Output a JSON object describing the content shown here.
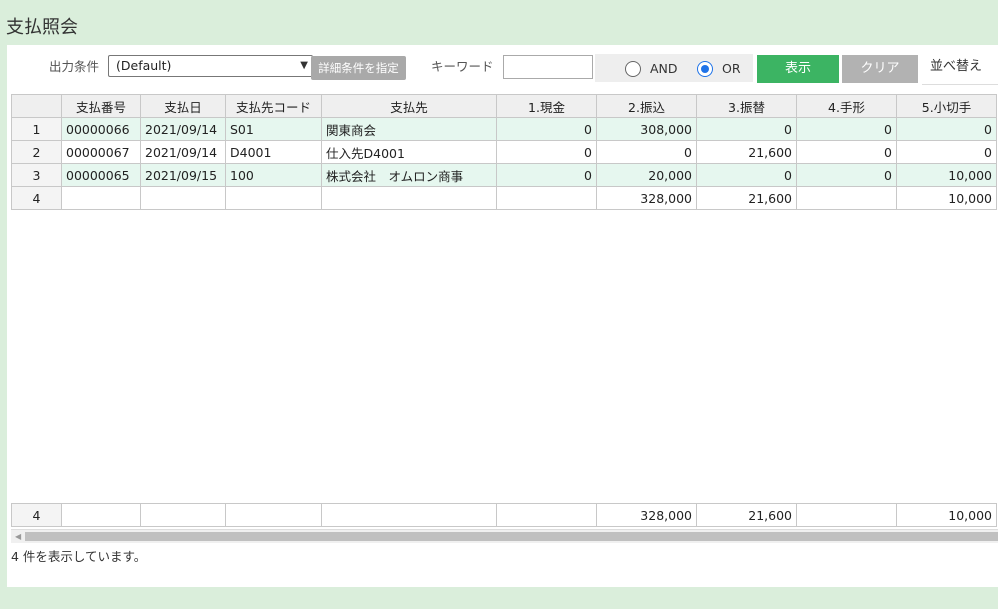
{
  "title": "支払照会",
  "filter": {
    "output_label": "出力条件",
    "output_value": "(Default)",
    "detail_button": "詳細条件を指定",
    "keyword_label": "キーワード",
    "keyword_value": "",
    "radio_and": "AND",
    "radio_or": "OR",
    "radio_selected": "OR",
    "show_button": "表示",
    "clear_button": "クリア",
    "sort_button": "並べ替え"
  },
  "table": {
    "headers": [
      "",
      "支払番号",
      "支払日",
      "支払先コード",
      "支払先",
      "1.現金",
      "2.振込",
      "3.振替",
      "4.手形",
      "5.小切手"
    ],
    "rows": [
      [
        "1",
        "00000066",
        "2021/09/14",
        "S01",
        "関東商会",
        "0",
        "308,000",
        "0",
        "0",
        "0"
      ],
      [
        "2",
        "00000067",
        "2021/09/14",
        "D4001",
        "仕入先D4001",
        "0",
        "0",
        "21,600",
        "0",
        "0"
      ],
      [
        "3",
        "00000065",
        "2021/09/15",
        "100",
        "株式会社　オムロン商事",
        "0",
        "20,000",
        "0",
        "0",
        "10,000"
      ],
      [
        "4",
        "",
        "",
        "",
        "",
        "",
        "328,000",
        "21,600",
        "",
        "10,000"
      ]
    ],
    "footer": [
      "4",
      "",
      "",
      "",
      "",
      "",
      "328,000",
      "21,600",
      "",
      "10,000"
    ]
  },
  "status_text": "4 件を表示しています。",
  "colors": {
    "show_button": "#3cb463",
    "clear_button": "#b2b2b2",
    "background": "#daeedb",
    "row_highlight": "#e6f7ef",
    "radio_selected": "#1f73e8"
  },
  "icons": {
    "select": "chevron-down-icon",
    "scroll_left": "arrow-left-icon"
  }
}
